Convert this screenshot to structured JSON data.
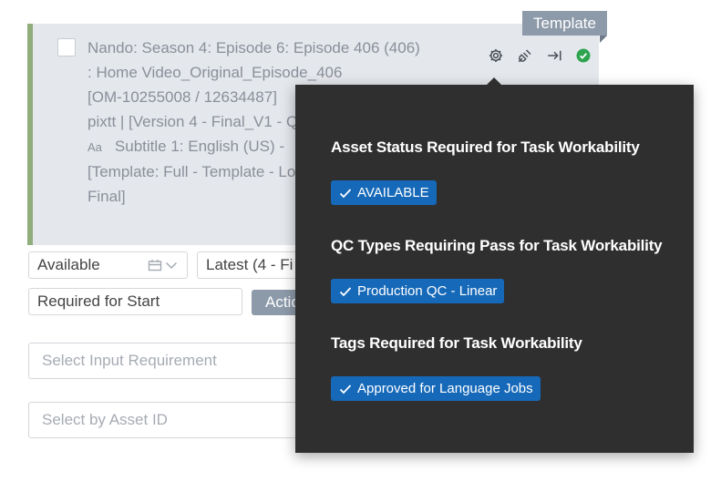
{
  "card": {
    "lines": [
      "Nando: Season 4: Episode 6: Episode 406 (406)",
      ": Home Video_Original_Episode_406",
      "[OM-10255008 / 12634487]",
      "pixtt | [Version 4 - Final_V1 - Q",
      "Subtitle 1: English (US) -",
      "[Template: Full - Template - Lo",
      "Final]"
    ],
    "subtitle_prefix": "Aa",
    "icons": [
      "gear-icon",
      "plug-icon",
      "arrow-to-right-icon",
      "check-circle-icon"
    ],
    "template_tag": "Template"
  },
  "filters": {
    "status_value": "Available",
    "version_value": "Latest (4 - Fi",
    "requirement_value": "Required for Start",
    "action_label": "Action"
  },
  "inputs": {
    "input_requirement_placeholder": "Select Input Requirement",
    "asset_id_placeholder": "Select by Asset ID"
  },
  "popover": {
    "sections": [
      {
        "title": "Asset Status Required for Task Workability",
        "badge": "AVAILABLE"
      },
      {
        "title": "QC Types Requiring Pass for Task Workability",
        "badge": "Production QC - Linear"
      },
      {
        "title": "Tags Required for Task Workability",
        "badge": "Approved for Language Jobs"
      }
    ]
  },
  "colors": {
    "card_bg": "#e4e7ec",
    "card_accent": "#8fae7c",
    "popover_bg": "#2f2f2f",
    "badge_bg": "#1669b8",
    "tag_bg": "#8d9aaa",
    "success": "#2ea44f"
  }
}
